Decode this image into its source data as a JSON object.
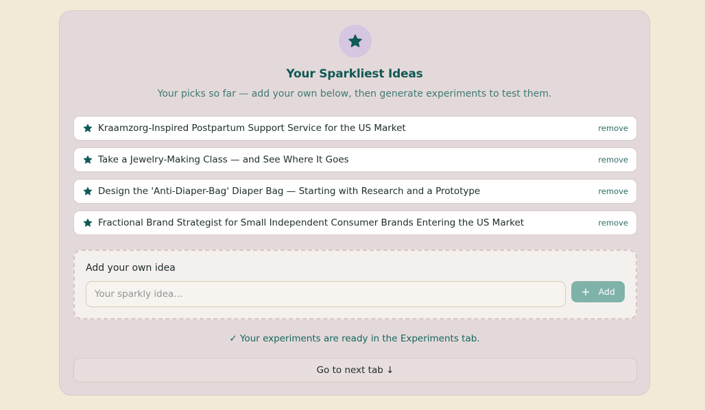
{
  "header": {
    "badge_icon": "star-icon",
    "title": "Your Sparkliest Ideas",
    "subtitle": "Your picks so far — add your own below, then generate experiments to test them."
  },
  "ideas": [
    {
      "icon": "star-icon",
      "text": "Kraamzorg-Inspired Postpartum Support Service for the US Market",
      "remove_label": "remove"
    },
    {
      "icon": "star-icon",
      "text": "Take a Jewelry-Making Class — and See Where It Goes",
      "remove_label": "remove"
    },
    {
      "icon": "star-icon",
      "text": "Design the 'Anti-Diaper-Bag' Diaper Bag — Starting with Research and a Prototype",
      "remove_label": "remove"
    },
    {
      "icon": "star-icon",
      "text": "Fractional Brand Strategist for Small Independent Consumer Brands Entering the US Market",
      "remove_label": "remove"
    }
  ],
  "add_idea": {
    "label": "Add your own idea",
    "value": "",
    "placeholder": "Your sparkly idea...",
    "button_icon": "plus-icon",
    "button_label": "Add"
  },
  "status": {
    "text": "✓ Your experiments are ready in the Experiments tab."
  },
  "next": {
    "label": "Go to next tab ↓"
  },
  "colors": {
    "page_background": "#f2ead7",
    "card_background": "#e4d9da",
    "accent": "#0f5a55",
    "badge_background": "#d5c6e1",
    "add_button": "#7fb2a9"
  }
}
